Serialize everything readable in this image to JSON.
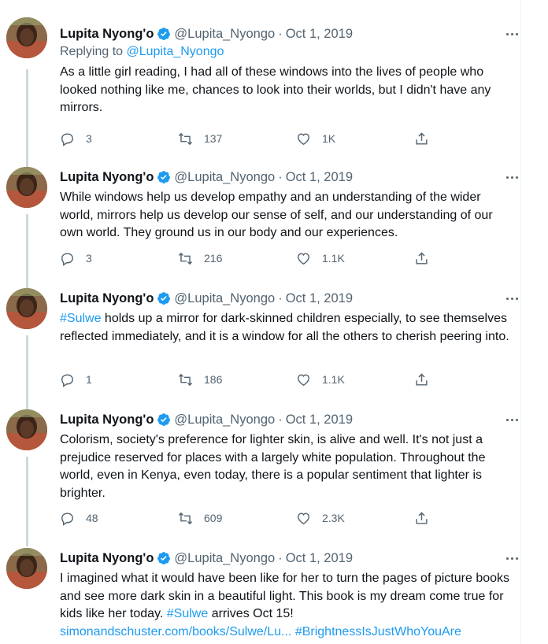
{
  "colors": {
    "accent": "#1d9bf0",
    "muted": "#536471",
    "thread": "#cfd9de",
    "text": "#0f1419"
  },
  "tweets": [
    {
      "name": "Lupita Nyong'o",
      "handle": "@Lupita_Nyongo",
      "dot": "·",
      "date": "Oct 1, 2019",
      "reply_prefix": "Replying to ",
      "reply_handle": "@Lupita_Nyongo",
      "text": "As a little girl reading, I had all of these windows into the lives of people who looked nothing like me, chances to look into their worlds, but I didn't have any mirrors.",
      "replies": "3",
      "retweets": "137",
      "likes": "1K"
    },
    {
      "name": "Lupita Nyong'o",
      "handle": "@Lupita_Nyongo",
      "dot": "·",
      "date": "Oct 1, 2019",
      "text": "While windows help us develop empathy and an understanding of the wider world, mirrors help us develop our sense of self, and our understanding of our own world. They ground us in our body and our experiences.",
      "replies": "3",
      "retweets": "216",
      "likes": "1.1K"
    },
    {
      "name": "Lupita Nyong'o",
      "handle": "@Lupita_Nyongo",
      "dot": "·",
      "date": "Oct 1, 2019",
      "hashtag": "#Sulwe",
      "text": " holds up a mirror for dark-skinned children especially, to see themselves reflected immediately, and it is a window for all the others to cherish peering into.",
      "replies": "1",
      "retweets": "186",
      "likes": "1.1K"
    },
    {
      "name": "Lupita Nyong'o",
      "handle": "@Lupita_Nyongo",
      "dot": "·",
      "date": "Oct 1, 2019",
      "text": "Colorism, society's preference for lighter skin, is alive and well. It's not just a prejudice reserved for places with a largely white population. Throughout the world, even in Kenya, even today, there is a popular sentiment that lighter is brighter.",
      "replies": "48",
      "retweets": "609",
      "likes": "2.3K"
    },
    {
      "name": "Lupita Nyong'o",
      "handle": "@Lupita_Nyongo",
      "dot": "·",
      "date": "Oct 1, 2019",
      "text": "I imagined what it would have been like for her to turn the pages of picture books and see more dark skin in a beautiful light. This book is my dream come true for kids like her today. ",
      "hashtag": "#Sulwe",
      "text_after": " arrives Oct 15!",
      "link": "simonandschuster.com/books/Sulwe/Lu...",
      "hashtag2": "#BrightnessIsJustWhoYouAre"
    }
  ]
}
